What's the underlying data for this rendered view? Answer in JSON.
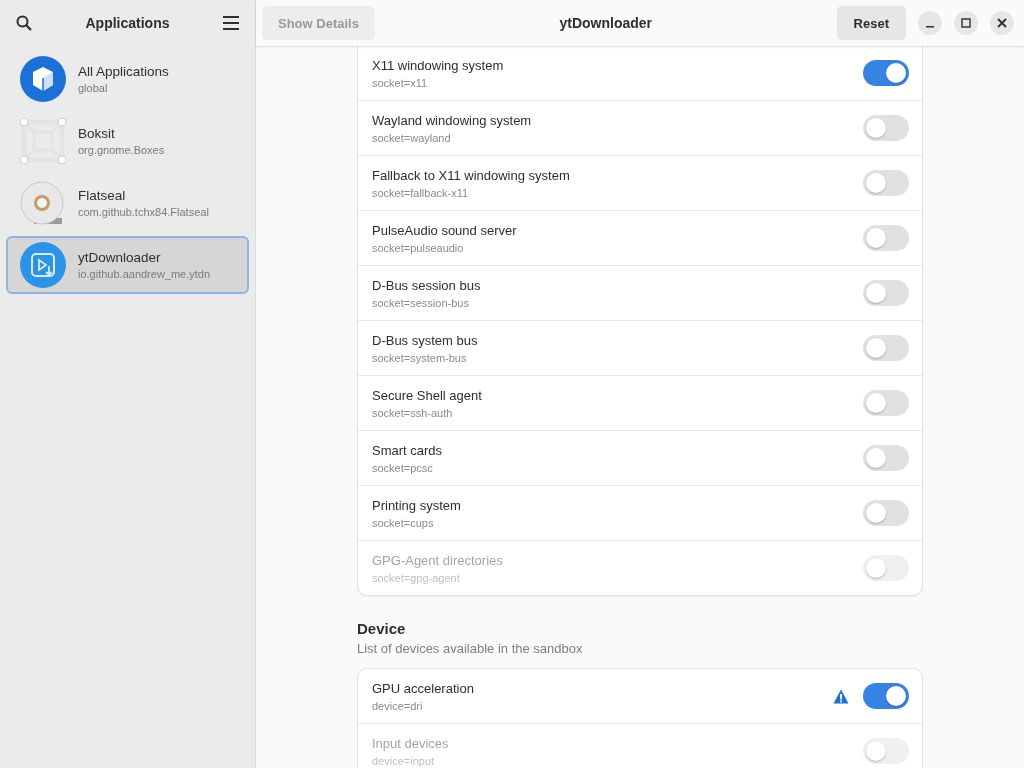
{
  "sidebar": {
    "title": "Applications",
    "items": [
      {
        "name": "All Applications",
        "id_text": "global",
        "selected": false
      },
      {
        "name": "Boksit",
        "id_text": "org.gnome.Boxes",
        "selected": false
      },
      {
        "name": "Flatseal",
        "id_text": "com.github.tchx84.Flatseal",
        "selected": false
      },
      {
        "name": "ytDownloader",
        "id_text": "io.github.aandrew_me.ytdn",
        "selected": true
      }
    ]
  },
  "header": {
    "left_button": "Show Details",
    "left_button_disabled": true,
    "title": "ytDownloader",
    "reset_button": "Reset"
  },
  "sections": [
    {
      "rows": [
        {
          "title": "X11 windowing system",
          "subtitle": "socket=x11",
          "on": true,
          "disabled": false,
          "warning": false
        },
        {
          "title": "Wayland windowing system",
          "subtitle": "socket=wayland",
          "on": false,
          "disabled": false,
          "warning": false
        },
        {
          "title": "Fallback to X11 windowing system",
          "subtitle": "socket=fallback-x11",
          "on": false,
          "disabled": false,
          "warning": false
        },
        {
          "title": "PulseAudio sound server",
          "subtitle": "socket=pulseaudio",
          "on": false,
          "disabled": false,
          "warning": false
        },
        {
          "title": "D-Bus session bus",
          "subtitle": "socket=session-bus",
          "on": false,
          "disabled": false,
          "warning": false
        },
        {
          "title": "D-Bus system bus",
          "subtitle": "socket=system-bus",
          "on": false,
          "disabled": false,
          "warning": false
        },
        {
          "title": "Secure Shell agent",
          "subtitle": "socket=ssh-auth",
          "on": false,
          "disabled": false,
          "warning": false
        },
        {
          "title": "Smart cards",
          "subtitle": "socket=pcsc",
          "on": false,
          "disabled": false,
          "warning": false
        },
        {
          "title": "Printing system",
          "subtitle": "socket=cups",
          "on": false,
          "disabled": false,
          "warning": false
        },
        {
          "title": "GPG-Agent directories",
          "subtitle": "socket=gpg-agent",
          "on": false,
          "disabled": true,
          "warning": false
        }
      ]
    },
    {
      "heading": "Device",
      "description": "List of devices available in the sandbox",
      "rows": [
        {
          "title": "GPU acceleration",
          "subtitle": "device=dri",
          "on": true,
          "disabled": false,
          "warning": true
        },
        {
          "title": "Input devices",
          "subtitle": "device=input",
          "on": false,
          "disabled": true,
          "warning": false
        }
      ]
    }
  ]
}
